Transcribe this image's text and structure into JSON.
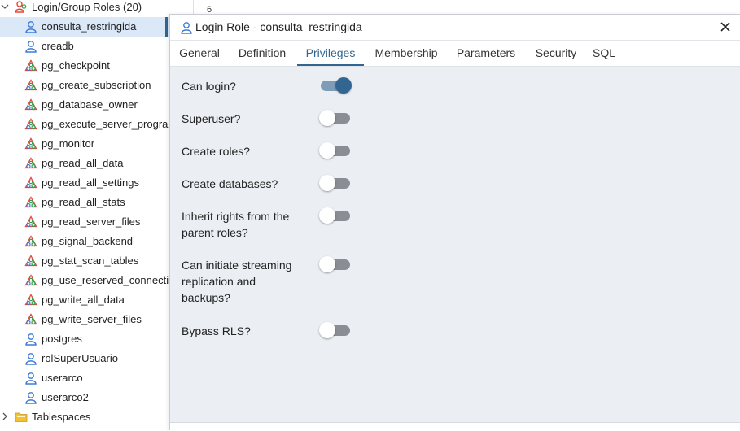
{
  "tree": {
    "group": {
      "label": "Login/Group Roles (20)",
      "chevron": "chevron-down-icon"
    },
    "roles": [
      {
        "label": "consulta_restringida",
        "icon": "login-role-icon",
        "selected": true
      },
      {
        "label": "creadb",
        "icon": "login-role-icon"
      },
      {
        "label": "pg_checkpoint",
        "icon": "group-role-icon"
      },
      {
        "label": "pg_create_subscription",
        "icon": "group-role-icon"
      },
      {
        "label": "pg_database_owner",
        "icon": "group-role-icon"
      },
      {
        "label": "pg_execute_server_progra",
        "icon": "group-role-icon"
      },
      {
        "label": "pg_monitor",
        "icon": "group-role-icon"
      },
      {
        "label": "pg_read_all_data",
        "icon": "group-role-icon"
      },
      {
        "label": "pg_read_all_settings",
        "icon": "group-role-icon"
      },
      {
        "label": "pg_read_all_stats",
        "icon": "group-role-icon"
      },
      {
        "label": "pg_read_server_files",
        "icon": "group-role-icon"
      },
      {
        "label": "pg_signal_backend",
        "icon": "group-role-icon"
      },
      {
        "label": "pg_stat_scan_tables",
        "icon": "group-role-icon"
      },
      {
        "label": "pg_use_reserved_connecti",
        "icon": "group-role-icon"
      },
      {
        "label": "pg_write_all_data",
        "icon": "group-role-icon"
      },
      {
        "label": "pg_write_server_files",
        "icon": "group-role-icon"
      },
      {
        "label": "postgres",
        "icon": "login-role-icon"
      },
      {
        "label": "rolSuperUsuario",
        "icon": "login-role-icon"
      },
      {
        "label": "userarco",
        "icon": "login-role-icon"
      },
      {
        "label": "userarco2",
        "icon": "login-role-icon"
      }
    ],
    "tablespaces": {
      "label": "Tablespaces",
      "chevron": "chevron-right-icon"
    }
  },
  "background": {
    "line_number": "6"
  },
  "dialog": {
    "title": "Login Role - consulta_restringida",
    "tabs": [
      {
        "label": "General"
      },
      {
        "label": "Definition"
      },
      {
        "label": "Privileges",
        "active": true
      },
      {
        "label": "Membership"
      },
      {
        "label": "Parameters"
      },
      {
        "label": "Security"
      },
      {
        "label": "SQL"
      }
    ],
    "privileges": [
      {
        "label": "Can login?",
        "value": true
      },
      {
        "label": "Superuser?",
        "value": false
      },
      {
        "label": "Create roles?",
        "value": false
      },
      {
        "label": "Create databases?",
        "value": false
      },
      {
        "label": "Inherit rights from the parent roles?",
        "value": false
      },
      {
        "label": "Can initiate streaming replication and backups?",
        "value": false
      },
      {
        "label": "Bypass RLS?",
        "value": false
      }
    ]
  },
  "colors": {
    "accent": "#326690",
    "selected_row": "#dbe8f7",
    "panel_bg": "#ebeef3",
    "switch_off": "#8a8d93",
    "login_role_icon": "#3e7bd6",
    "group_role_red": "#e0483e",
    "group_role_green": "#2f9e4a",
    "folder": "#f2c230"
  }
}
